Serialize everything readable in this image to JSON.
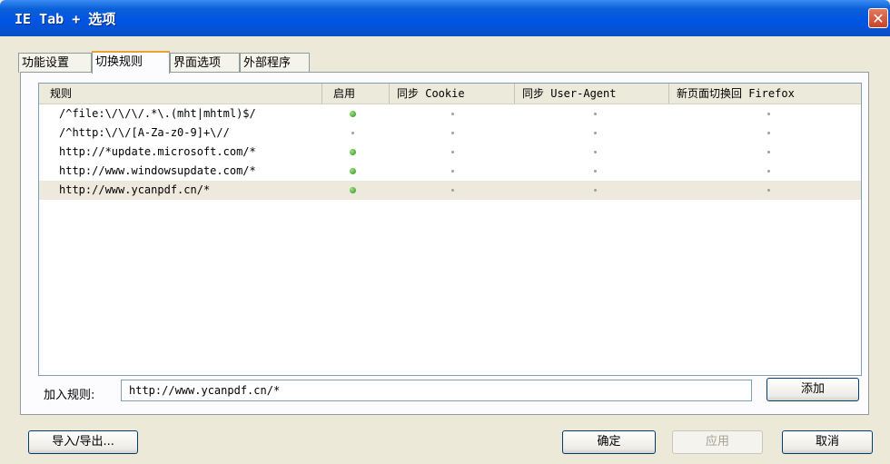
{
  "window": {
    "title": "IE Tab + 选项",
    "close_glyph": "✕"
  },
  "tabs": [
    {
      "label": "功能设置",
      "active": false
    },
    {
      "label": "切换规则",
      "active": true
    },
    {
      "label": "界面选项",
      "active": false
    },
    {
      "label": "外部程序",
      "active": false
    }
  ],
  "table": {
    "columns": [
      "规则",
      "启用",
      "同步 Cookie",
      "同步 User-Agent",
      "新页面切换回 Firefox"
    ],
    "rows": [
      {
        "rule": "/^file:\\/\\/\\/.*\\.(mht|mhtml)$/",
        "enabled": true,
        "sync_cookie": false,
        "sync_ua": false,
        "switch_back": false,
        "selected": false
      },
      {
        "rule": "/^http:\\/\\/[A-Za-z0-9]+\\//",
        "enabled": false,
        "sync_cookie": false,
        "sync_ua": false,
        "switch_back": false,
        "selected": false
      },
      {
        "rule": "http://*update.microsoft.com/*",
        "enabled": true,
        "sync_cookie": false,
        "sync_ua": false,
        "switch_back": false,
        "selected": false
      },
      {
        "rule": "http://www.windowsupdate.com/*",
        "enabled": true,
        "sync_cookie": false,
        "sync_ua": false,
        "switch_back": false,
        "selected": false
      },
      {
        "rule": "http://www.ycanpdf.cn/*",
        "enabled": true,
        "sync_cookie": false,
        "sync_ua": false,
        "switch_back": false,
        "selected": true
      }
    ]
  },
  "add_rule": {
    "label": "加入规则:",
    "value": "http://www.ycanpdf.cn/*",
    "button": "添加"
  },
  "footer": {
    "import_export": "导入/导出...",
    "ok": "确定",
    "apply": "应用",
    "cancel": "取消"
  },
  "colors": {
    "titlebar": "#0054e3",
    "tab_highlight": "#e6a33c",
    "enabled_dot": "#2f8f22",
    "selected_row": "#ede9dd"
  }
}
